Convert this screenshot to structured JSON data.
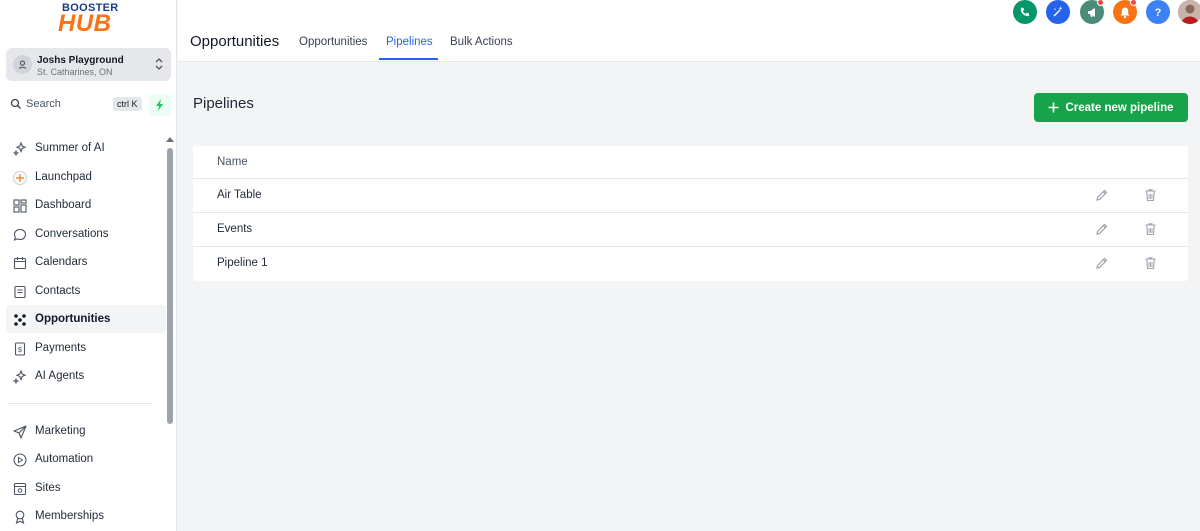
{
  "brand": {
    "line1": "BOOSTER",
    "line2": "HUB"
  },
  "account": {
    "name": "Joshs Playground",
    "location": "St. Catharines, ON"
  },
  "search": {
    "label": "Search",
    "shortcut": "ctrl K"
  },
  "sidebar": {
    "items": [
      {
        "label": "Summer of AI",
        "icon": "sparkles-icon"
      },
      {
        "label": "Launchpad",
        "icon": "launchpad-icon"
      },
      {
        "label": "Dashboard",
        "icon": "dashboard-icon"
      },
      {
        "label": "Conversations",
        "icon": "chat-bubble-icon"
      },
      {
        "label": "Calendars",
        "icon": "calendar-icon"
      },
      {
        "label": "Contacts",
        "icon": "contacts-icon"
      },
      {
        "label": "Opportunities",
        "icon": "opportunities-icon",
        "active": true
      },
      {
        "label": "Payments",
        "icon": "payments-icon"
      },
      {
        "label": "AI Agents",
        "icon": "sparkles-icon"
      }
    ],
    "items2": [
      {
        "label": "Marketing",
        "icon": "send-icon"
      },
      {
        "label": "Automation",
        "icon": "automation-icon"
      },
      {
        "label": "Sites",
        "icon": "sites-icon"
      },
      {
        "label": "Memberships",
        "icon": "memberships-icon"
      }
    ]
  },
  "header": {
    "title": "Opportunities",
    "tabs": [
      {
        "label": "Opportunities"
      },
      {
        "label": "Pipelines",
        "active": true
      },
      {
        "label": "Bulk Actions"
      }
    ]
  },
  "main": {
    "title": "Pipelines",
    "create_label": "Create new pipeline",
    "table": {
      "column": "Name",
      "rows": [
        {
          "name": "Air Table"
        },
        {
          "name": "Events"
        },
        {
          "name": "Pipeline 1"
        }
      ]
    }
  },
  "colors": {
    "accent": "#2563eb",
    "primary_button": "#16a34a",
    "phone": "#059669",
    "ai": "#2563eb",
    "announce": "#4b8b7a",
    "notify": "#f97316",
    "help": "#3b82f6"
  }
}
